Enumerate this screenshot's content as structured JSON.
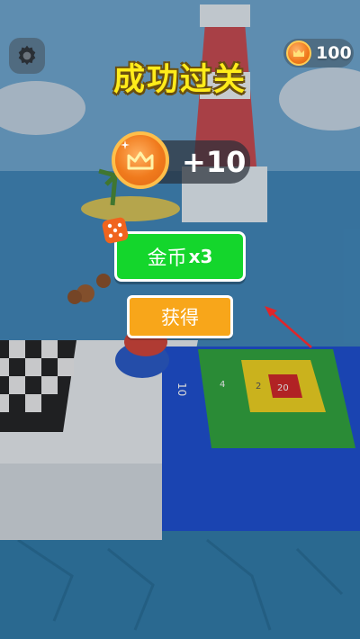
{
  "hud": {
    "coin_count": "100",
    "settings_icon": "gear-icon",
    "coin_icon": "crown-coin-icon"
  },
  "result": {
    "title": "成功过关",
    "reward_amount": "+10",
    "reward_icon": "crown-coin-icon"
  },
  "buttons": {
    "multiply_label": "金币",
    "multiply_factor": "x3",
    "multiply_icon": "dice-icon",
    "claim_label": "获得"
  },
  "board": {
    "tile_numbers": [
      "10",
      "4",
      "2",
      "20"
    ]
  },
  "colors": {
    "title_yellow": "#ffec1a",
    "coin_orange": "#f07a1c",
    "button_green": "#14d62c",
    "button_orange": "#f8a61a",
    "arrow_red": "#e0252a"
  }
}
